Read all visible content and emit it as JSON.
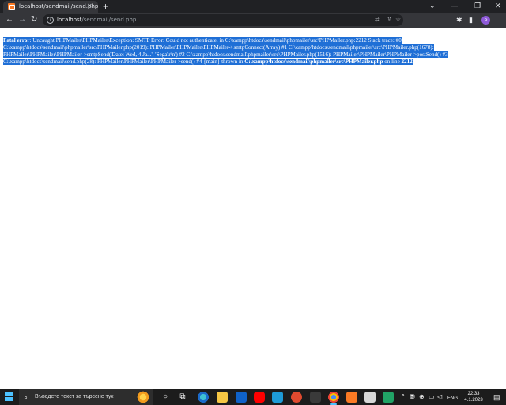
{
  "browser": {
    "tab_title": "localhost/sendmail/send.php",
    "tab_close": "✕",
    "new_tab": "+",
    "window_controls": {
      "dropdown": "⌄",
      "minimize": "—",
      "restore": "❐",
      "close": "✕"
    },
    "nav": {
      "back": "←",
      "forward": "→",
      "reload": "↻"
    },
    "url_host": "localhost",
    "url_path": "/sendmail/send.php",
    "profile_initial": "Б"
  },
  "page": {
    "error_label": "Fatal error",
    "error_message": ": Uncaught PHPMailer\\PHPMailer\\Exception: SMTP Error: Could not authenticate. in C:\\xampp\\htdocs\\sendmail\\phpmailer\\src\\PHPMailer.php:2212 Stack trace: #0 C:\\xampp\\htdocs\\sendmail\\phpmailer\\src\\PHPMailer.php(2019): PHPMailer\\PHPMailer\\PHPMailer->smtpConnect(Array) #1 C:\\xampp\\htdocs\\sendmail\\phpmailer\\src\\PHPMailer.php(1678): PHPMailer\\PHPMailer\\PHPMailer->smtpSend('Date: Wed, 4 Ja...', 'Sega\\r\\n') #2 C:\\xampp\\htdocs\\sendmail\\phpmailer\\src\\PHPMailer.php(1516): PHPMailer\\PHPMailer\\PHPMailer->postSend() #3 C:\\xampp\\htdocs\\sendmail\\send.php(28): PHPMailer\\PHPMailer\\PHPMailer->send() #4 {main} thrown in ",
    "error_file": "C:\\xampp\\htdocs\\sendmail\\phpmailer\\src\\PHPMailer.php",
    "on_line_text": " on line ",
    "error_line": "2212"
  },
  "taskbar": {
    "search_placeholder": "Въведете текст за търсене тук",
    "language": "ENG",
    "time": "22:33",
    "date": "4.1.2023"
  },
  "colors": {
    "selection": "#1f6fd6",
    "tabstrip": "#202124",
    "toolbar": "#35363a",
    "taskbar": "#1c1c1c"
  }
}
